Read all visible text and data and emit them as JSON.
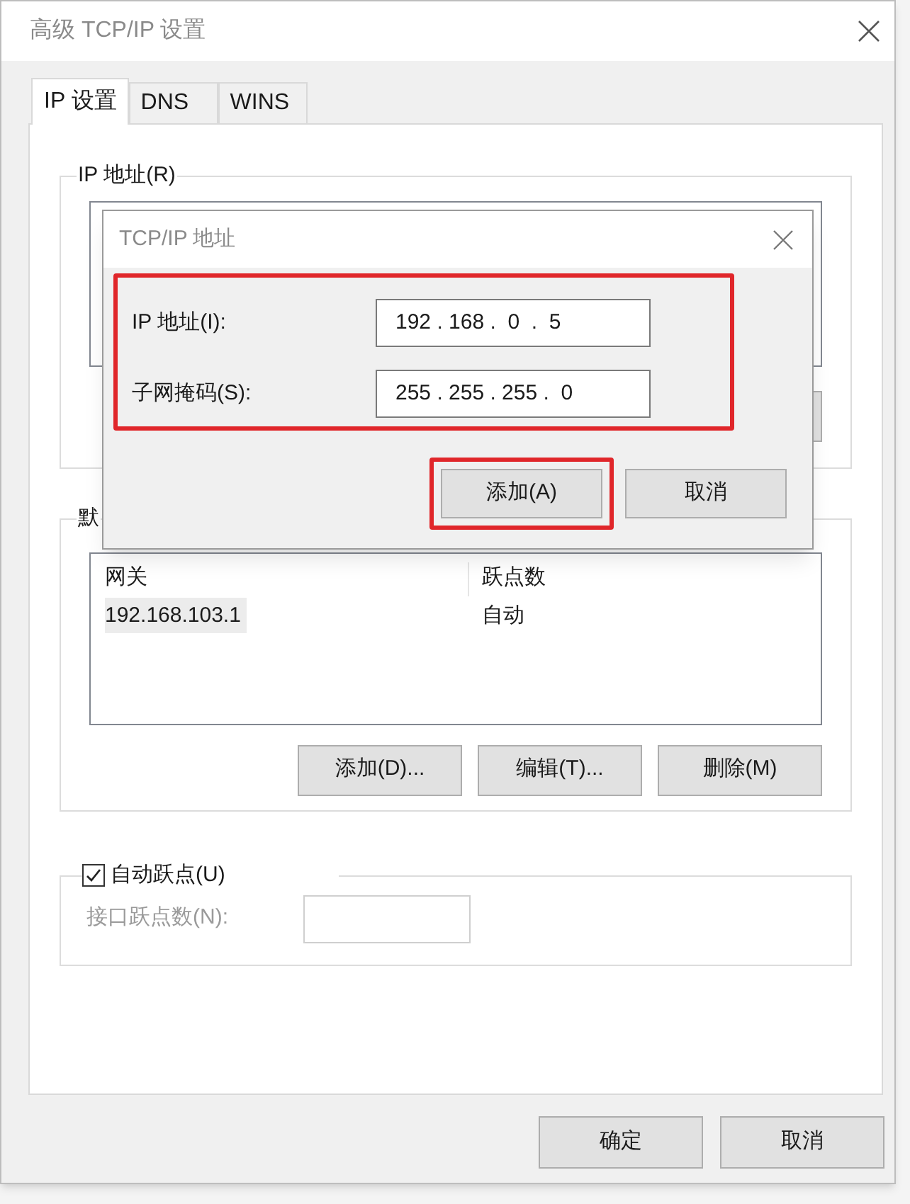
{
  "window": {
    "title": "高级 TCP/IP 设置"
  },
  "tabs": [
    {
      "label": "IP 设置",
      "selected": true
    },
    {
      "label": "DNS",
      "selected": false
    },
    {
      "label": "WINS",
      "selected": false
    }
  ],
  "ip_group": {
    "title": "IP 地址(R)"
  },
  "gateway_group": {
    "title": "默",
    "columns": [
      "网关",
      "跃点数"
    ],
    "rows": [
      {
        "cells": [
          "192.168.103.1",
          "自动"
        ],
        "selected": true
      }
    ],
    "buttons": [
      "添加(D)...",
      "编辑(T)...",
      "删除(M)"
    ]
  },
  "metric_group": {
    "checkbox": {
      "label": "自动跃点(U)",
      "checked": true
    },
    "field": {
      "label": "接口跃点数(N):",
      "disabled": true
    }
  },
  "buttons": [
    "确定",
    "取消"
  ],
  "dialog": {
    "title": "TCP/IP 地址",
    "highlighted": true,
    "fields": [
      {
        "label": "IP 地址(I):",
        "value": "192 . 168 .  0  .  5"
      },
      {
        "label": "子网掩码(S):",
        "value": "255 . 255 . 255 .  0"
      }
    ],
    "buttons": [
      {
        "label": "添加(A)",
        "highlighted": true
      },
      {
        "label": "取消",
        "highlighted": false
      }
    ]
  }
}
